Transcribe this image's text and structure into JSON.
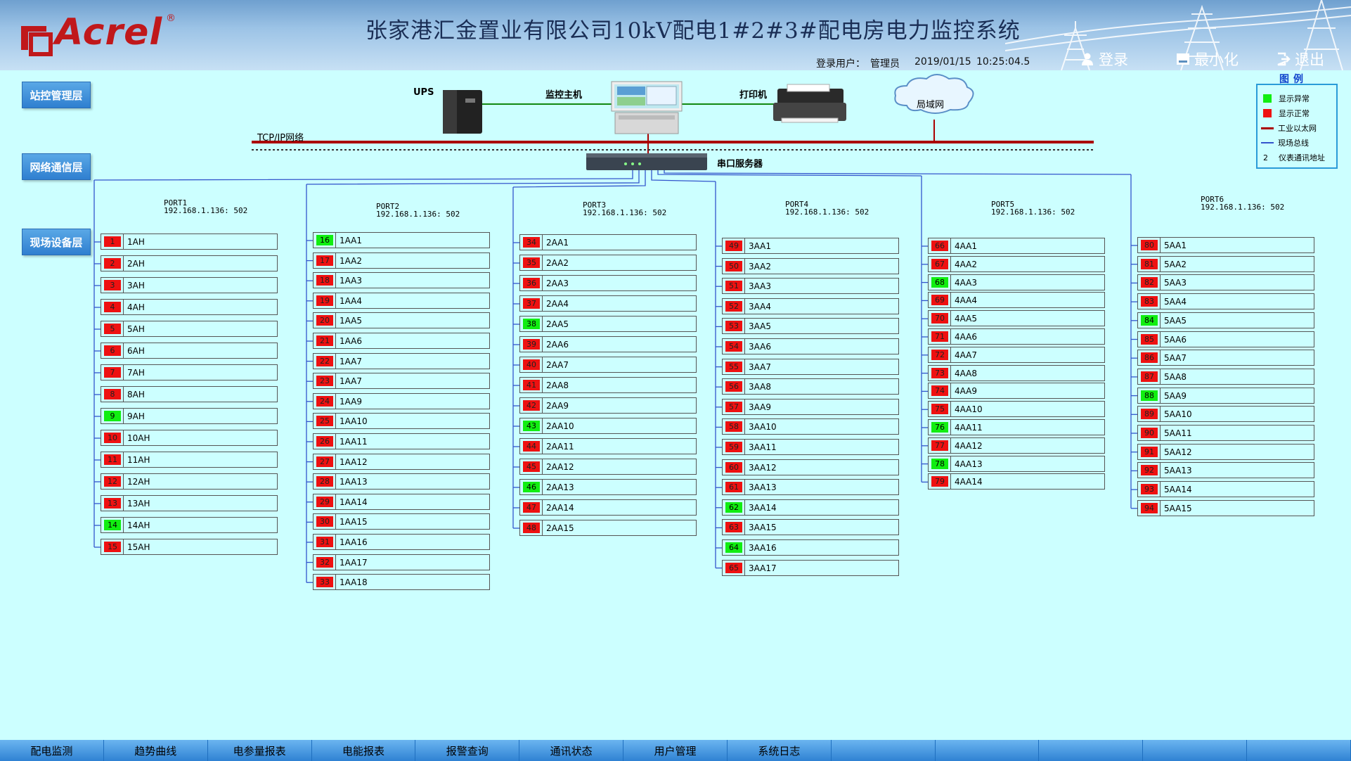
{
  "header": {
    "logo_text": "Acrel",
    "logo_mark": "®",
    "title": "张家港汇金置业有限公司10kV配电1#2#3#配电房电力监控系统",
    "login_user_label": "登录用户：",
    "login_user": "管理员",
    "date": "2019/01/15",
    "time": "10:25:04.5",
    "btn_login": "登录",
    "btn_minimize": "最小化",
    "btn_exit": "退出"
  },
  "layers": {
    "station": "站控管理层",
    "network": "网络通信层",
    "field": "现场设备层"
  },
  "devices": {
    "ups": "UPS",
    "host": "监控主机",
    "printer": "打印机",
    "lan": "局域网",
    "tcp": "TCP/IP网络",
    "serial": "串口服务器"
  },
  "legend": {
    "title": "图例",
    "items": [
      {
        "label": "显示异常",
        "color": "#11ee11",
        "kind": "square"
      },
      {
        "label": "显示正常",
        "color": "#ee1111",
        "kind": "square"
      },
      {
        "label": "工业以太网",
        "color": "#aa0000",
        "kind": "line"
      },
      {
        "label": "现场总线",
        "color": "#3355cc",
        "kind": "line"
      },
      {
        "label": "仪表通讯地址",
        "symbol": "2",
        "kind": "text"
      }
    ]
  },
  "ports": [
    {
      "name": "PORT1",
      "ip": "192.168.1.136: 502",
      "rows": [
        {
          "addr": "1",
          "status": "bad",
          "name": "1AH"
        },
        {
          "addr": "2",
          "status": "bad",
          "name": "2AH"
        },
        {
          "addr": "3",
          "status": "bad",
          "name": "3AH"
        },
        {
          "addr": "4",
          "status": "bad",
          "name": "4AH"
        },
        {
          "addr": "5",
          "status": "bad",
          "name": "5AH"
        },
        {
          "addr": "6",
          "status": "bad",
          "name": "6AH"
        },
        {
          "addr": "7",
          "status": "bad",
          "name": "7AH"
        },
        {
          "addr": "8",
          "status": "bad",
          "name": "8AH"
        },
        {
          "addr": "9",
          "status": "ok",
          "name": "9AH"
        },
        {
          "addr": "10",
          "status": "bad",
          "name": "10AH"
        },
        {
          "addr": "11",
          "status": "bad",
          "name": "11AH"
        },
        {
          "addr": "12",
          "status": "bad",
          "name": "12AH"
        },
        {
          "addr": "13",
          "status": "bad",
          "name": "13AH"
        },
        {
          "addr": "14",
          "status": "ok",
          "name": "14AH"
        },
        {
          "addr": "15",
          "status": "bad",
          "name": "15AH"
        }
      ]
    },
    {
      "name": "PORT2",
      "ip": "192.168.1.136: 502",
      "rows": [
        {
          "addr": "16",
          "status": "ok",
          "name": "1AA1"
        },
        {
          "addr": "17",
          "status": "bad",
          "name": "1AA2"
        },
        {
          "addr": "18",
          "status": "bad",
          "name": "1AA3"
        },
        {
          "addr": "19",
          "status": "bad",
          "name": "1AA4"
        },
        {
          "addr": "20",
          "status": "bad",
          "name": "1AA5"
        },
        {
          "addr": "21",
          "status": "bad",
          "name": "1AA6"
        },
        {
          "addr": "22",
          "status": "bad",
          "name": "1AA7"
        },
        {
          "addr": "23",
          "status": "bad",
          "name": "1AA7"
        },
        {
          "addr": "24",
          "status": "bad",
          "name": "1AA9"
        },
        {
          "addr": "25",
          "status": "bad",
          "name": "1AA10"
        },
        {
          "addr": "26",
          "status": "bad",
          "name": "1AA11"
        },
        {
          "addr": "27",
          "status": "bad",
          "name": "1AA12"
        },
        {
          "addr": "28",
          "status": "bad",
          "name": "1AA13"
        },
        {
          "addr": "29",
          "status": "bad",
          "name": "1AA14"
        },
        {
          "addr": "30",
          "status": "bad",
          "name": "1AA15"
        },
        {
          "addr": "31",
          "status": "bad",
          "name": "1AA16"
        },
        {
          "addr": "32",
          "status": "bad",
          "name": "1AA17"
        },
        {
          "addr": "33",
          "status": "bad",
          "name": "1AA18"
        }
      ]
    },
    {
      "name": "PORT3",
      "ip": "192.168.1.136: 502",
      "rows": [
        {
          "addr": "34",
          "status": "bad",
          "name": "2AA1"
        },
        {
          "addr": "35",
          "status": "bad",
          "name": "2AA2"
        },
        {
          "addr": "36",
          "status": "bad",
          "name": "2AA3"
        },
        {
          "addr": "37",
          "status": "bad",
          "name": "2AA4"
        },
        {
          "addr": "38",
          "status": "ok",
          "name": "2AA5"
        },
        {
          "addr": "39",
          "status": "bad",
          "name": "2AA6"
        },
        {
          "addr": "40",
          "status": "bad",
          "name": "2AA7"
        },
        {
          "addr": "41",
          "status": "bad",
          "name": "2AA8"
        },
        {
          "addr": "42",
          "status": "bad",
          "name": "2AA9"
        },
        {
          "addr": "43",
          "status": "ok",
          "name": "2AA10"
        },
        {
          "addr": "44",
          "status": "bad",
          "name": "2AA11"
        },
        {
          "addr": "45",
          "status": "bad",
          "name": "2AA12"
        },
        {
          "addr": "46",
          "status": "ok",
          "name": "2AA13"
        },
        {
          "addr": "47",
          "status": "bad",
          "name": "2AA14"
        },
        {
          "addr": "48",
          "status": "bad",
          "name": "2AA15"
        }
      ]
    },
    {
      "name": "PORT4",
      "ip": "192.168.1.136: 502",
      "rows": [
        {
          "addr": "49",
          "status": "bad",
          "name": "3AA1"
        },
        {
          "addr": "50",
          "status": "bad",
          "name": "3AA2"
        },
        {
          "addr": "51",
          "status": "bad",
          "name": "3AA3"
        },
        {
          "addr": "52",
          "status": "bad",
          "name": "3AA4"
        },
        {
          "addr": "53",
          "status": "bad",
          "name": "3AA5"
        },
        {
          "addr": "54",
          "status": "bad",
          "name": "3AA6"
        },
        {
          "addr": "55",
          "status": "bad",
          "name": "3AA7"
        },
        {
          "addr": "56",
          "status": "bad",
          "name": "3AA8"
        },
        {
          "addr": "57",
          "status": "bad",
          "name": "3AA9"
        },
        {
          "addr": "58",
          "status": "bad",
          "name": "3AA10"
        },
        {
          "addr": "59",
          "status": "bad",
          "name": "3AA11"
        },
        {
          "addr": "60",
          "status": "bad",
          "name": "3AA12"
        },
        {
          "addr": "61",
          "status": "bad",
          "name": "3AA13"
        },
        {
          "addr": "62",
          "status": "ok",
          "name": "3AA14"
        },
        {
          "addr": "63",
          "status": "bad",
          "name": "3AA15"
        },
        {
          "addr": "64",
          "status": "ok",
          "name": "3AA16"
        },
        {
          "addr": "65",
          "status": "bad",
          "name": "3AA17"
        }
      ]
    },
    {
      "name": "PORT5",
      "ip": "192.168.1.136: 502",
      "rows": [
        {
          "addr": "66",
          "status": "bad",
          "name": "4AA1"
        },
        {
          "addr": "67",
          "status": "bad",
          "name": "4AA2"
        },
        {
          "addr": "68",
          "status": "ok",
          "name": "4AA3"
        },
        {
          "addr": "69",
          "status": "bad",
          "name": "4AA4"
        },
        {
          "addr": "70",
          "status": "bad",
          "name": "4AA5"
        },
        {
          "addr": "71",
          "status": "bad",
          "name": "4AA6"
        },
        {
          "addr": "72",
          "status": "bad",
          "name": "4AA7"
        },
        {
          "addr": "73",
          "status": "bad",
          "name": "4AA8"
        },
        {
          "addr": "74",
          "status": "bad",
          "name": "4AA9"
        },
        {
          "addr": "75",
          "status": "bad",
          "name": "4AA10"
        },
        {
          "addr": "76",
          "status": "ok",
          "name": "4AA11"
        },
        {
          "addr": "77",
          "status": "bad",
          "name": "4AA12"
        },
        {
          "addr": "78",
          "status": "ok",
          "name": "4AA13"
        },
        {
          "addr": "79",
          "status": "bad",
          "name": "4AA14"
        }
      ]
    },
    {
      "name": "PORT6",
      "ip": "192.168.1.136: 502",
      "rows": [
        {
          "addr": "80",
          "status": "bad",
          "name": "5AA1"
        },
        {
          "addr": "81",
          "status": "bad",
          "name": "5AA2"
        },
        {
          "addr": "82",
          "status": "bad",
          "name": "5AA3"
        },
        {
          "addr": "83",
          "status": "bad",
          "name": "5AA4"
        },
        {
          "addr": "84",
          "status": "ok",
          "name": "5AA5"
        },
        {
          "addr": "85",
          "status": "bad",
          "name": "5AA6"
        },
        {
          "addr": "86",
          "status": "bad",
          "name": "5AA7"
        },
        {
          "addr": "87",
          "status": "bad",
          "name": "5AA8"
        },
        {
          "addr": "88",
          "status": "ok",
          "name": "5AA9"
        },
        {
          "addr": "89",
          "status": "bad",
          "name": "5AA10"
        },
        {
          "addr": "90",
          "status": "bad",
          "name": "5AA11"
        },
        {
          "addr": "91",
          "status": "bad",
          "name": "5AA12"
        },
        {
          "addr": "92",
          "status": "bad",
          "name": "5AA13"
        },
        {
          "addr": "93",
          "status": "bad",
          "name": "5AA14"
        },
        {
          "addr": "94",
          "status": "bad",
          "name": "5AA15"
        }
      ]
    }
  ],
  "nav": [
    {
      "label": "配电监测"
    },
    {
      "label": "趋势曲线"
    },
    {
      "label": "电参量报表"
    },
    {
      "label": "电能报表"
    },
    {
      "label": "报警查询"
    },
    {
      "label": "通讯状态"
    },
    {
      "label": "用户管理"
    },
    {
      "label": "系统日志"
    },
    {
      "label": ""
    },
    {
      "label": ""
    },
    {
      "label": ""
    },
    {
      "label": ""
    },
    {
      "label": ""
    }
  ]
}
